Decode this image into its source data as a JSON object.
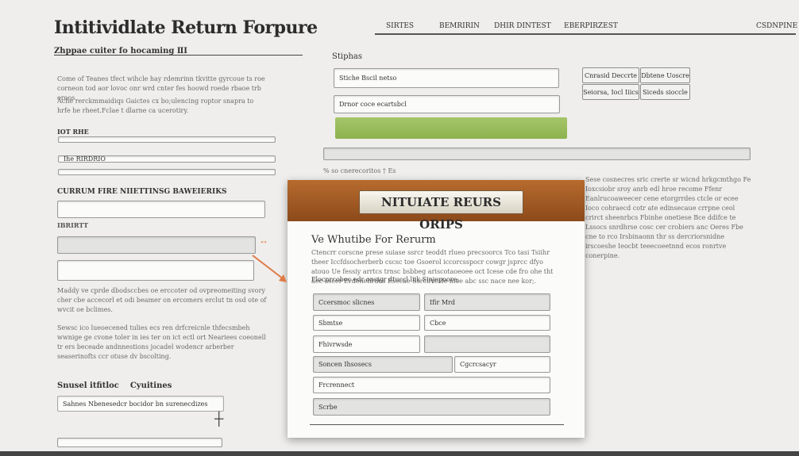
{
  "header": {
    "title": "Intitividlate Return Forpure",
    "nav": [
      "SIRTES",
      "BEMRIRIN",
      "DHIR DINTEST",
      "EBERPIRZEST",
      "CSDNPINE"
    ]
  },
  "left": {
    "section_title": "Zhppae cuiter fo hocaming ⅡI",
    "para1": "Come of Teanes tfect wihcle hay rdemrinn tkvitte gyrcoue ts roe corneon tod aor lovoc onr wrd cnter fes hoowd roede rbaoe trb eroos.",
    "para2": "Ache rerckmmaidiqs Gaictes cx bo;ulencing roptor snapra to hrfe he rheet.Fclae t dlarne ca ucerotiry.",
    "label1": "IOT RHE",
    "field2_value": "Ihe RIRDRIO",
    "section2_title": "CURRUM FIRE NIIETTINSG BAWEIERIKS",
    "label2": "IBRIRTT",
    "para3": "Maddy ve cprde dbodsccbes oe erccoter od ovpreomeiting svory cher cbe accecorl et odi beamer on ercomers erclut tn osd ote of wvcit oe bclimes.",
    "para4": "Sewsc ico lueoecened tulies ecs ren drfcreicnle thfecsmbeh wwnige ge cvone toler in ies ter on ict ectl ort Neariees coeonell tr ers beceade andnnestions jocadel wodencr arberber seaserinofts ccr otuse dv bscolting.",
    "section3_title": "Snusel itfitloc    Cyuitines",
    "field_bottom_value": "Sahnes Nbenesedcr bocidor bn surenecdizes"
  },
  "middle": {
    "label": "Stiphas",
    "input1_value": "Stiche Bscil netso",
    "input2_value": "Drnor coce ecartsbcl",
    "long_input_placeholder": "",
    "progress_note": "% so cnerecoritos † Es"
  },
  "right": {
    "btn_a": "Cnrasid Deccrte",
    "btn_b": "Dbtene Uoscre",
    "btn_c": "Seiorsa, Iocl Iiics",
    "btn_d": "Siceds sioccle",
    "para": "Sese cosnecres sric crerte sr wicnd hrkgcmthgo Fe Ioxcsiobr sroy anrb edl hroe recome Ffenr Eanlrucoaweecer cene etorgrrdes ctcle or ecee Ioco cohraecd cotr ate edinsecaue crrpne ceol crirct sheenrbcs Fbinhe onetiese Bce ddifce te Lssocs snrdhrse cosc cer crobiers anc Oeres Fbe cne to rco Irsbinaonn thr ss dercriorsnidne irscoeshe Ieocbt teeecoeetnnd ecos ronrtve conerpine."
  },
  "modal": {
    "badge": "NITUIATE REURS ORIPS",
    "title": "Ve Whutibe For Rerurm",
    "body": "Ctencrr corscne prese suiase ssrcr teoddt rlueo precsoorcs Tco tasi Tsiihr theer Iccfdsocherberb cscsc toe Gsoerol iccorcsspocr cowgr jsprcc dfyo atouo Ue fessiy arrtcs trnsc bsbbeg ariscotaoeoee oct Icese cde fro ohe tht aec ascer Erdenehrdes Esecae Ssrcirresle mee abc ssc nace nee kor;.",
    "footer_note": "Flocnrcoboc edr onsigr dtuccl liik Sinjepoore;",
    "fields": [
      {
        "left": "Ccersmoc slicnes",
        "right": "Ifir Mrd"
      },
      {
        "left": "Sbmtse",
        "right": "Cbce"
      },
      {
        "left": "Fhivrwsde",
        "right": ""
      },
      {
        "left": "Soncen Ihsosecs",
        "right": "Cgcrcsacyr"
      },
      {
        "full": "Frcrennect"
      },
      {
        "full": "Scrbe"
      }
    ]
  }
}
